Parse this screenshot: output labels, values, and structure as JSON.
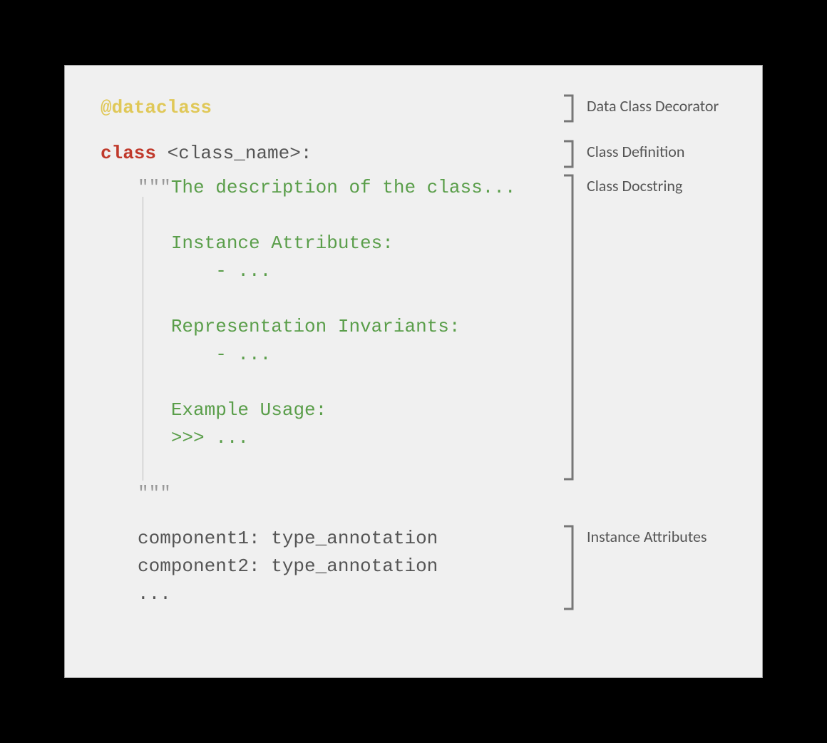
{
  "sections": {
    "decorator": {
      "code": "@dataclass",
      "label": "Data Class Decorator"
    },
    "definition": {
      "keyword": "class",
      "rest": " <class_name>:",
      "label": "Class Definition"
    },
    "docstring": {
      "open_quotes": "\"\"\"",
      "line_desc": "The description of the class...",
      "section_attrs": "Instance Attributes:",
      "bullet_attrs": "    - ...",
      "section_inv": "Representation Invariants:",
      "bullet_inv": "    - ...",
      "section_example": "Example Usage:",
      "example_body": ">>> ...",
      "close_quotes": "\"\"\"",
      "label": "Class Docstring"
    },
    "attributes": {
      "line1": "component1: type_annotation",
      "line2": "component2: type_annotation",
      "line3": "...",
      "label": "Instance Attributes"
    }
  }
}
